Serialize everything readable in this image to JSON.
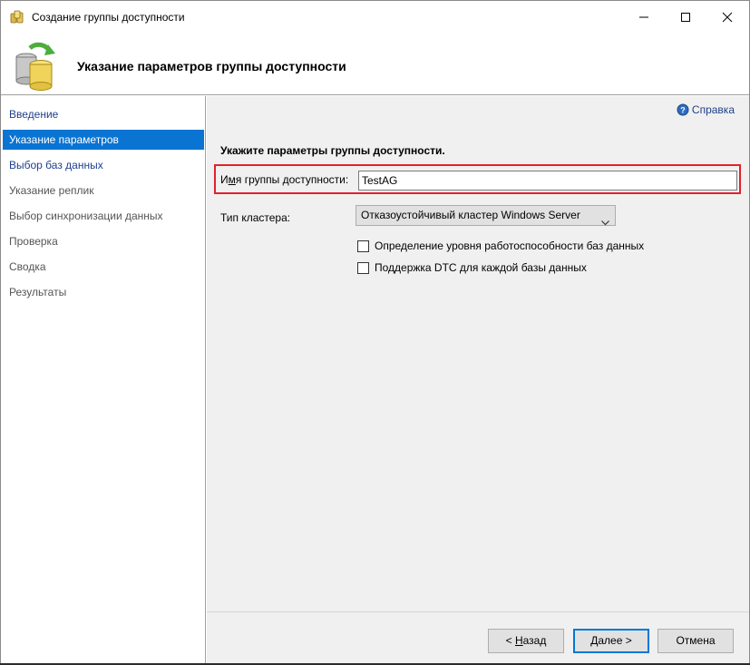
{
  "window": {
    "title": "Создание группы доступности",
    "icon": "availability-group-app-icon"
  },
  "header": {
    "title": "Указание параметров группы доступности",
    "icon": "database-sync-icon"
  },
  "sidebar": {
    "items": [
      {
        "label": "Введение",
        "state": "link"
      },
      {
        "label": "Указание параметров",
        "state": "active"
      },
      {
        "label": "Выбор баз данных",
        "state": "link"
      },
      {
        "label": "Указание реплик",
        "state": "disabled"
      },
      {
        "label": "Выбор синхронизации данных",
        "state": "disabled"
      },
      {
        "label": "Проверка",
        "state": "disabled"
      },
      {
        "label": "Сводка",
        "state": "disabled"
      },
      {
        "label": "Результаты",
        "state": "disabled"
      }
    ]
  },
  "main": {
    "help_label": "Справка",
    "section_title": "Укажите параметры группы доступности.",
    "name_label_pre": "И",
    "name_label_acc": "м",
    "name_label_post": "я группы доступности:",
    "name_value": "TestAG",
    "cluster_label": "Тип кластера:",
    "cluster_value": "Отказоустойчивый кластер Windows Server",
    "checkboxes": [
      {
        "label": "Определение уровня работоспособности баз данных",
        "checked": false
      },
      {
        "label": "Поддержка DTC для каждой базы данных",
        "checked": false
      }
    ]
  },
  "footer": {
    "back_pre": "< ",
    "back_acc": "Н",
    "back_post": "азад",
    "next_pre": "",
    "next_acc": "Д",
    "next_post": "алее >",
    "cancel_label": "Отмена"
  },
  "colors": {
    "accent": "#0a74d2",
    "link": "#1f3f8c",
    "highlight_frame": "#e0222b"
  }
}
